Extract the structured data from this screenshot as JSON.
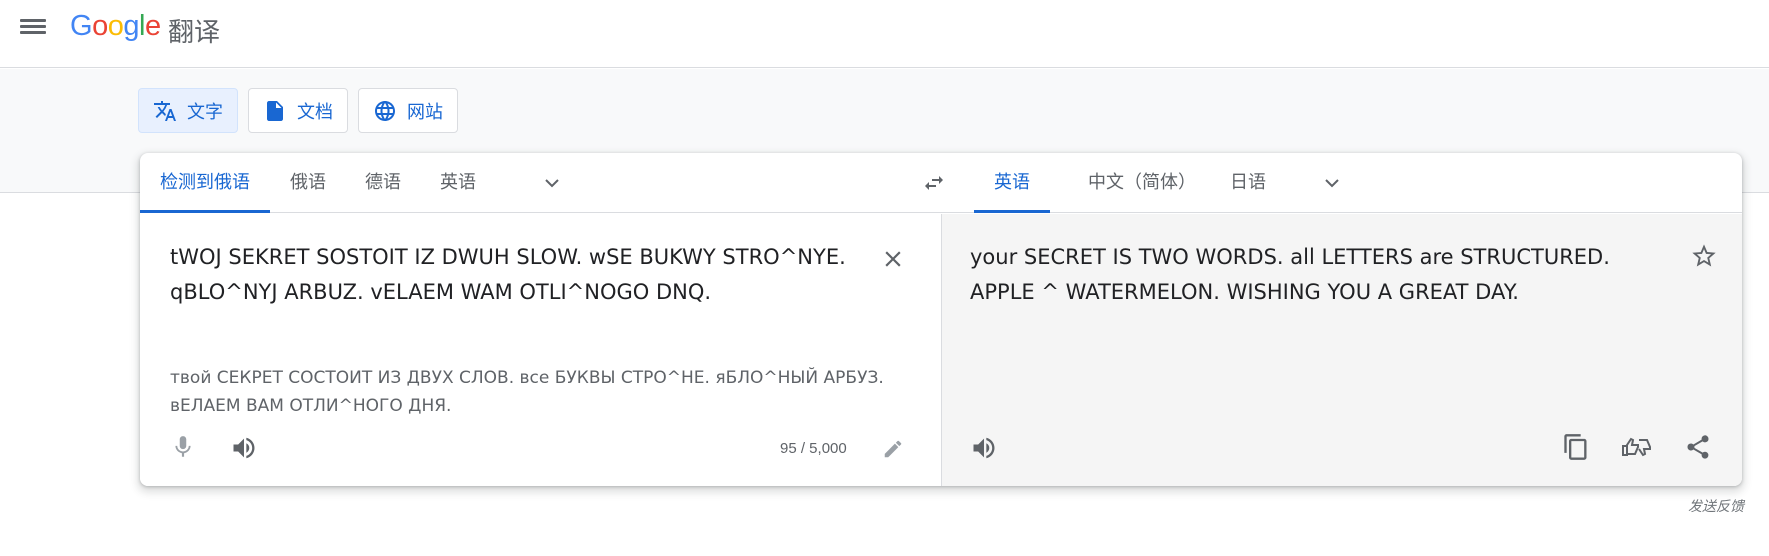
{
  "header": {
    "logo": {
      "g": "G",
      "o1": "o",
      "o2": "o",
      "g2": "g",
      "l": "l",
      "e": "e"
    },
    "product": "翻译",
    "menu_icon": "hamburger-menu-icon"
  },
  "modes": [
    {
      "label": "文字",
      "icon": "translate-icon",
      "active": true
    },
    {
      "label": "文档",
      "icon": "document-icon",
      "active": false
    },
    {
      "label": "网站",
      "icon": "globe-icon",
      "active": false
    }
  ],
  "source_langs": [
    "检测到俄语",
    "俄语",
    "德语",
    "英语"
  ],
  "target_langs": [
    "英语",
    "中文（简体）",
    "日语"
  ],
  "source": {
    "text": "tWOJ SEKRET SOSTOIT IZ DWUH SLOW. wSE BUKWY STRO^NYE. qBLO^NYJ ARBUZ. vELAEM WAM OTLI^NOGO DNQ.",
    "transliteration": "твой СЕКРЕТ СОСТОИТ ИЗ ДВУХ СЛОВ. все БУКВЫ СТРО^НЕ. яБЛО^НЫЙ АРБУЗ. вЕЛАЕМ ВАМ ОТЛИ^НОГО ДНЯ.",
    "char_count": "95 / 5,000"
  },
  "target": {
    "text": "your SECRET IS TWO WORDS. all LETTERS are STRUCTURED. APPLE ^ WATERMELON. WISHING YOU A GREAT DAY."
  },
  "feedback": "发送反馈",
  "colors": {
    "accent": "#1967d2",
    "active_bg": "#e8f0fe",
    "band": "#f8f9fa",
    "target_bg": "#f5f5f5"
  }
}
